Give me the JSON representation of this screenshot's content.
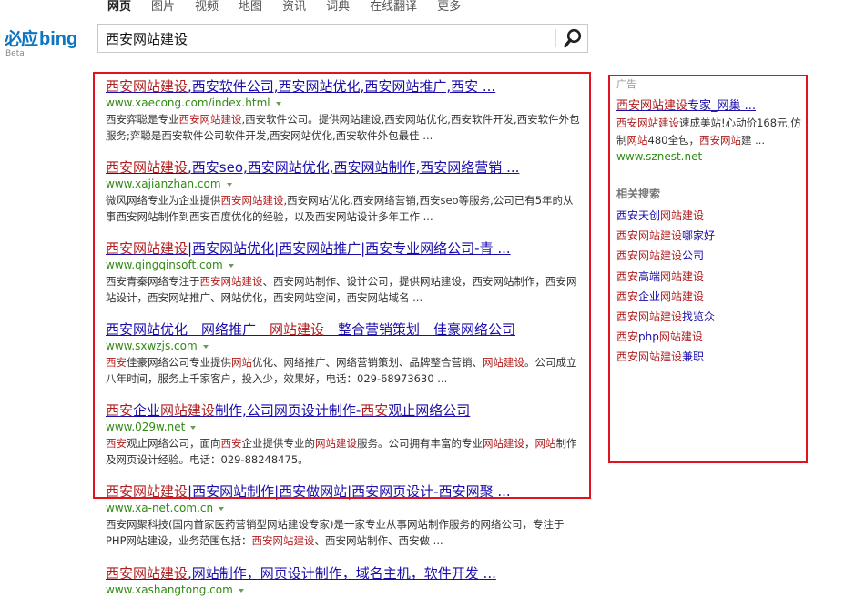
{
  "nav": {
    "items": [
      {
        "label": "网页",
        "active": true
      },
      {
        "label": "图片",
        "active": false
      },
      {
        "label": "视频",
        "active": false
      },
      {
        "label": "地图",
        "active": false
      },
      {
        "label": "资讯",
        "active": false
      },
      {
        "label": "词典",
        "active": false
      },
      {
        "label": "在线翻译",
        "active": false
      },
      {
        "label": "更多",
        "active": false
      }
    ]
  },
  "logo": {
    "cn": "必应",
    "en": "bing",
    "beta": "Beta"
  },
  "search": {
    "query": "西安网站建设",
    "button_icon": "magnifier-icon"
  },
  "results": [
    {
      "title": [
        [
          "西安网站建设",
          1
        ],
        [
          ",西安软件公司,西安网站优化,西安网站推广,西安 ...",
          0
        ]
      ],
      "url": "www.xaecong.com/index.html",
      "desc": [
        [
          "西安弈聪是专业",
          0
        ],
        [
          "西安网站建设",
          1
        ],
        [
          ",西安软件公司。提供网站建设,西安网站优化,西安软件开发,西安软件外包服务;弈聪是西安软件公司软件开发,西安网站优化,西安软件外包最佳 ...",
          0
        ]
      ]
    },
    {
      "title": [
        [
          "西安网站建设",
          1
        ],
        [
          ",西安seo,西安网站优化,西安网站制作,西安网络营销 ...",
          0
        ]
      ],
      "url": "www.xajianzhan.com",
      "desc": [
        [
          "微风网络专业为企业提供",
          0
        ],
        [
          "西安网站建设",
          1
        ],
        [
          ",西安网站优化,西安网络营销,西安seo等服务,公司已有5年的从事西安网站制作到西安百度优化的经验，以及西安网站设计多年工作 ...",
          0
        ]
      ]
    },
    {
      "title": [
        [
          "西安网站建设",
          1
        ],
        [
          "|西安网站优化|西安网站推广|西安专业网络公司-青 ...",
          0
        ]
      ],
      "url": "www.qingqinsoft.com",
      "desc": [
        [
          "西安青秦网络专注于",
          0
        ],
        [
          "西安网站建设",
          1
        ],
        [
          "、西安网站制作、设计公司，提供网站建设，西安网站制作，西安网站设计，西安网站推广、网站优化，西安网站空间，西安网站域名 ...",
          0
        ]
      ]
    },
    {
      "title": [
        [
          "西安网站优化　网络推广　",
          0
        ],
        [
          "网站建设",
          1
        ],
        [
          "　整合营销策划　佳豪网络公司",
          0
        ]
      ],
      "url": "www.sxwzjs.com",
      "desc": [
        [
          "西安",
          1
        ],
        [
          "佳豪网络公司专业提供",
          0
        ],
        [
          "网站",
          1
        ],
        [
          "优化、网络推广、网络营销策划、品牌整合营销、",
          0
        ],
        [
          "网站建设",
          1
        ],
        [
          "。公司成立八年时间，服务上千家客户，投入少，效果好，电话：029-68973630 ...",
          0
        ]
      ]
    },
    {
      "title": [
        [
          "西安",
          1
        ],
        [
          "企业",
          0
        ],
        [
          "网站建设",
          1
        ],
        [
          "制作,公司网页设计制作-",
          0
        ],
        [
          "西安",
          1
        ],
        [
          "观止网络公司",
          0
        ]
      ],
      "url": "www.029w.net",
      "desc": [
        [
          "西安",
          1
        ],
        [
          "观止网络公司，面向",
          0
        ],
        [
          "西安",
          1
        ],
        [
          "企业提供专业的",
          0
        ],
        [
          "网站建设",
          1
        ],
        [
          "服务。公司拥有丰富的专业",
          0
        ],
        [
          "网站建设",
          1
        ],
        [
          "，",
          0
        ],
        [
          "网站",
          1
        ],
        [
          "制作及网页设计经验。电话：029-88248475。",
          0
        ]
      ]
    },
    {
      "title": [
        [
          "西安网站建设",
          1
        ],
        [
          "|西安网站制作|西安做网站|西安网页设计-西安网聚 ...",
          0
        ]
      ],
      "url": "www.xa-net.com.cn",
      "desc": [
        [
          "西安网聚科技(国内首家医药营销型网站建设专家)是一家专业从事网站制作服务的网络公司，专注于PHP网站建设，业务范围包括：",
          0
        ],
        [
          "西安网站建设",
          1
        ],
        [
          "、西安网站制作、西安做 ...",
          0
        ]
      ]
    },
    {
      "title": [
        [
          "西安网站建设",
          1
        ],
        [
          ",网站制作，网页设计制作，域名主机，软件开发 ...",
          0
        ]
      ],
      "url": "www.xashangtong.com",
      "desc": []
    }
  ],
  "sidebar": {
    "ad_label": "广告",
    "ad": {
      "title": [
        [
          "西安网站建设",
          1
        ],
        [
          "专家_网巢 ...",
          0
        ]
      ],
      "desc": [
        [
          "西安网站建设",
          1
        ],
        [
          "速成美站!心动价168元,仿制",
          0
        ],
        [
          "网站",
          1
        ],
        [
          "480全包，",
          0
        ],
        [
          "西安网站",
          1
        ],
        [
          "建 ...",
          0
        ]
      ],
      "url": "www.sznest.net"
    },
    "related_heading": "相关搜索",
    "related": [
      [
        [
          "西安",
          0
        ],
        [
          "天创",
          0
        ],
        [
          "网站建设",
          1
        ]
      ],
      [
        [
          "西安网站建设",
          1
        ],
        [
          "哪家好",
          0
        ]
      ],
      [
        [
          "西安网站建设",
          1
        ],
        [
          "公司",
          0
        ]
      ],
      [
        [
          "西安",
          1
        ],
        [
          "高端",
          0
        ],
        [
          "网站建设",
          1
        ]
      ],
      [
        [
          "西安",
          1
        ],
        [
          "企业",
          0
        ],
        [
          "网站建设",
          1
        ]
      ],
      [
        [
          "西安网站建设",
          1
        ],
        [
          "找览众",
          0
        ]
      ],
      [
        [
          "西安",
          1
        ],
        [
          "php",
          0
        ],
        [
          "网站建设",
          1
        ]
      ],
      [
        [
          "西安网站建设",
          1
        ],
        [
          "兼职",
          0
        ]
      ]
    ]
  }
}
